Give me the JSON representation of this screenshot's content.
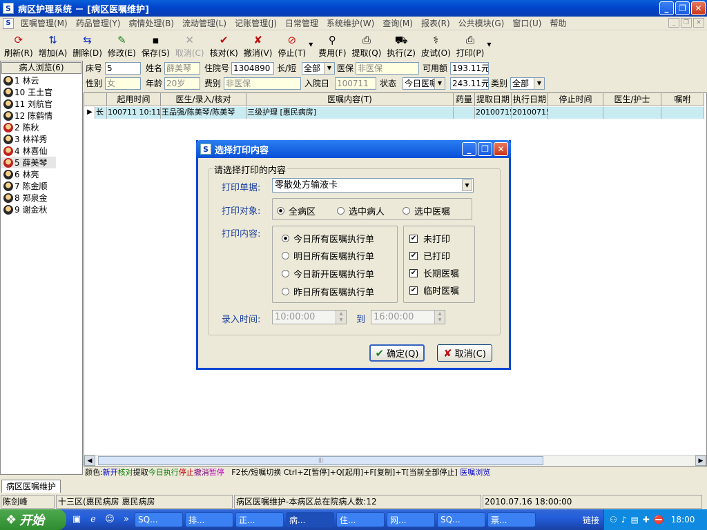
{
  "window": {
    "title": "病区护理系统 － [病区医嘱维护]",
    "icon_letter": "S",
    "controls": [
      "_",
      "❐",
      "✕"
    ]
  },
  "menubar": {
    "items": [
      "医嘱管理(M)",
      "药品管理(Y)",
      "病情处理(B)",
      "流动管理(L)",
      "记账管理(J)",
      "日常管理",
      "系统维护(W)",
      "查询(M)",
      "报表(R)",
      "公共模块(G)",
      "窗口(U)",
      "帮助"
    ],
    "mdi_controls": [
      "_",
      "❐",
      "✕"
    ]
  },
  "toolbar": {
    "buttons": [
      {
        "label": "刷新(R)",
        "icon": "refresh-icon",
        "glyph": "⟳",
        "color": "#c01010"
      },
      {
        "label": "增加(A)",
        "icon": "add-icon",
        "glyph": "⇅",
        "color": "#1030c0"
      },
      {
        "label": "删除(D)",
        "icon": "delete-icon",
        "glyph": "⇆",
        "color": "#1030c0"
      },
      {
        "label": "修改(E)",
        "icon": "edit-icon",
        "glyph": "✎",
        "color": "#208020"
      },
      {
        "label": "保存(S)",
        "icon": "save-icon",
        "glyph": "▪",
        "color": "#000000"
      },
      {
        "label": "取消(C)",
        "icon": "cancel-icon",
        "glyph": "✕",
        "color": "#a0a0a0",
        "disabled": true
      },
      {
        "label": "核对(K)",
        "icon": "check-icon",
        "glyph": "✔",
        "color": "#c01010"
      },
      {
        "label": "撤消(V)",
        "icon": "undo-icon",
        "glyph": "✘",
        "color": "#c01010"
      },
      {
        "label": "停止(T)",
        "icon": "stop-icon",
        "glyph": "⊘",
        "color": "#d01010"
      },
      {
        "label": "费用(F)",
        "icon": "fee-icon",
        "glyph": "⚲",
        "color": "#000000"
      },
      {
        "label": "提取(Q)",
        "icon": "extract-icon",
        "glyph": "⎙",
        "color": "#000000"
      },
      {
        "label": "执行(Z)",
        "icon": "execute-icon",
        "glyph": "⛟",
        "color": "#000000"
      },
      {
        "label": "皮试(O)",
        "icon": "skintest-icon",
        "glyph": "⚕",
        "color": "#000000"
      },
      {
        "label": "打印(P)",
        "icon": "printer-icon",
        "glyph": "⎙",
        "color": "#000000"
      }
    ]
  },
  "patients": {
    "title": "病人浏览(6)",
    "items": [
      {
        "label": "1 林云",
        "red": false
      },
      {
        "label": "10 王土官",
        "red": false
      },
      {
        "label": "11 刘航官",
        "red": false
      },
      {
        "label": "12 陈鹤情",
        "red": false
      },
      {
        "label": "2 陈秋",
        "red": true
      },
      {
        "label": "3 林祥秀",
        "red": false
      },
      {
        "label": "4 林喜仙",
        "red": true
      },
      {
        "label": "5 薛美琴",
        "red": true,
        "selected": true
      },
      {
        "label": "6 林亮",
        "red": false
      },
      {
        "label": "7 陈金顺",
        "red": false
      },
      {
        "label": "8 郑泉金",
        "red": false
      },
      {
        "label": "9 谢金秋",
        "red": false
      }
    ]
  },
  "info": {
    "bed_label": "床号",
    "bed": "5",
    "name_label": "姓名",
    "name": "薛美琴",
    "admission_no_label": "住院号",
    "admission_no": "1304890",
    "type_label": "长/短",
    "type": "全部",
    "insurance_label": "医保",
    "insurance": "非医保",
    "available_label": "可用额",
    "available": "193.11元",
    "sex_label": "性别",
    "sex": "女",
    "age_label": "年龄",
    "age": "20岁",
    "fee_type_label": "费别",
    "fee_type": "非医保",
    "admit_date_label": "入院日",
    "admit_date": "100711",
    "status_label": "状态",
    "status": "今日医嘱",
    "amount": "243.11元",
    "category_label": "类别",
    "category": "全部"
  },
  "grid": {
    "columns": [
      "",
      "起用时间",
      "医生/录入/核对",
      "医嘱内容(T)",
      "药量",
      "提取日期",
      "执行日期",
      "停止时间",
      "医生/护士",
      "嘱咐"
    ],
    "rows": [
      {
        "indicator": "▶",
        "type": "长",
        "start": "100711 10:11",
        "doctor": "王品强/陈美琴/陈美琴",
        "content": "三级护理  [惠民病房]",
        "dose": "",
        "extract": "20100715",
        "exec": "20100715",
        "stop": "",
        "nurse": "",
        "note": ""
      }
    ]
  },
  "legend": {
    "prefix": "颜色:",
    "items": [
      {
        "text": "新开",
        "color": "#0000cc"
      },
      {
        "text": "核对",
        "color": "#008000"
      },
      {
        "text": "提取",
        "color": "#000000"
      },
      {
        "text": "今日执行",
        "color": "#008000"
      },
      {
        "text": "停止",
        "color": "#c00000"
      },
      {
        "text": "撤消",
        "color": "#800080"
      },
      {
        "text": "暂停",
        "color": "#c000c0"
      }
    ],
    "hint": "F2长/短嘱切换   Ctrl+Z[暂停]+Q[起用]+F[复制]+T[当前全部停止]",
    "browse": "医嘱浏览"
  },
  "bottom_tab": "病区医嘱维护",
  "status": {
    "user": "陈剑峰",
    "ward": "十三区(惠民病房 惠民病房",
    "message": "病区医嘱维护-本病区总在院病人数:12",
    "datetime": "2010.07.16 18:00:00"
  },
  "taskbar": {
    "start": "开始",
    "tasks": [
      "SQ...",
      "排...",
      "正...",
      "病...",
      "住...",
      "网...",
      "SQ...",
      "票..."
    ],
    "active_index": 3,
    "links": "链接",
    "clock": "18:00"
  },
  "dialog": {
    "title": "选择打印内容",
    "group_title": "请选择打印的内容",
    "doc_label": "打印单据:",
    "doc_value": "零散处方输液卡",
    "target_label": "打印对象:",
    "targets": [
      {
        "label": "全病区",
        "checked": true
      },
      {
        "label": "选中病人",
        "checked": false
      },
      {
        "label": "选中医嘱",
        "checked": false
      }
    ],
    "content_label": "打印内容:",
    "contents": [
      {
        "label": "今日所有医嘱执行单",
        "checked": true
      },
      {
        "label": "明日所有医嘱执行单",
        "checked": false
      },
      {
        "label": "今日新开医嘱执行单",
        "checked": false
      },
      {
        "label": "昨日所有医嘱执行单",
        "checked": false
      }
    ],
    "checks": [
      {
        "label": "未打印",
        "checked": true
      },
      {
        "label": "已打印",
        "checked": true
      },
      {
        "label": "长期医嘱",
        "checked": true
      },
      {
        "label": "临时医嘱",
        "checked": true
      }
    ],
    "time_label": "录入时间:",
    "time_from": "10:00:00",
    "time_to_label": "到",
    "time_to": "16:00:00",
    "ok_label": "确定(Q)",
    "cancel_label": "取消(C)"
  }
}
